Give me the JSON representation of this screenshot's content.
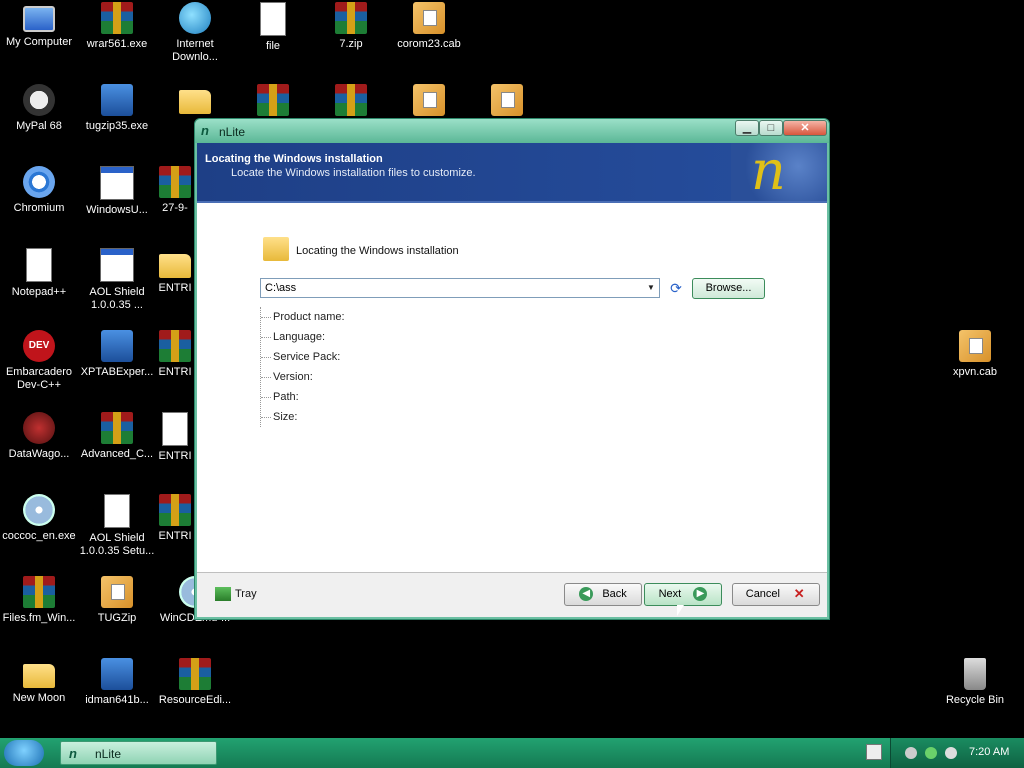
{
  "desktop": {
    "icons": [
      {
        "label": "My Computer"
      },
      {
        "label": "wrar561.exe"
      },
      {
        "label": "Internet Downlo..."
      },
      {
        "label": "file"
      },
      {
        "label": "7.zip"
      },
      {
        "label": "corom23.cab"
      },
      {
        "label": "MyPal 68"
      },
      {
        "label": "tugzip35.exe"
      },
      {
        "label": "Chromium"
      },
      {
        "label": "WindowsU..."
      },
      {
        "label": "27-9-"
      },
      {
        "label": "Notepad++"
      },
      {
        "label": "AOL Shield 1.0.0.35 ..."
      },
      {
        "label": "ENTRI"
      },
      {
        "label": "Embarcadero Dev-C++"
      },
      {
        "label": "XPTABExper..."
      },
      {
        "label": "ENTRI"
      },
      {
        "label": "DataWago..."
      },
      {
        "label": "Advanced_C..."
      },
      {
        "label": "ENTRI"
      },
      {
        "label": "coccoc_en.exe"
      },
      {
        "label": "AOL Shield 1.0.0.35 Setu..."
      },
      {
        "label": "ENTRI"
      },
      {
        "label": "Files.fm_Win..."
      },
      {
        "label": "TUGZip"
      },
      {
        "label": "WinCDEmu-..."
      },
      {
        "label": "New Moon"
      },
      {
        "label": "idman641b..."
      },
      {
        "label": "ResourceEdi..."
      },
      {
        "label": "xpvn.cab"
      },
      {
        "label": "Recycle Bin"
      }
    ]
  },
  "window": {
    "title": "nLite",
    "logo_glyph": "n",
    "buttons": {
      "minimize": "▁",
      "maximize": "□",
      "close": "✕"
    },
    "banner": {
      "heading": "Locating the Windows installation",
      "subheading": "Locate the Windows installation files to customize.",
      "logo_glyph": "n"
    },
    "section_title": "Locating the Windows installation",
    "path_value": "C:\\ass",
    "dropdown_arrow": "▼",
    "refresh_glyph": "⟳",
    "browse_label": "Browse...",
    "info": {
      "product_name": "Product name:",
      "language": "Language:",
      "service_pack": "Service Pack:",
      "version": "Version:",
      "path": "Path:",
      "size": "Size:"
    },
    "tray_label": "Tray",
    "back_label": "Back",
    "next_label": "Next",
    "cancel_label": "Cancel",
    "back_glyph": "◀",
    "next_glyph": "▶",
    "cancel_glyph": "✕"
  },
  "taskbar": {
    "task_label": "nLite",
    "task_glyph": "n",
    "clock": "7:20 AM"
  },
  "colors": {
    "accent": "#1e3f86",
    "title_green": "#5bb796",
    "taskbar_green": "#157a52"
  }
}
